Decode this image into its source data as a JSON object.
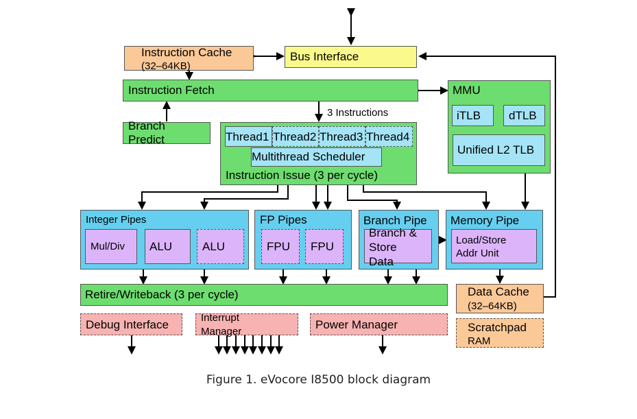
{
  "blocks": {
    "instruction_cache": {
      "title": "Instruction Cache",
      "subtitle": "(32–64KB)"
    },
    "bus_interface": {
      "title": "Bus Interface"
    },
    "instruction_fetch": {
      "title": "Instruction Fetch"
    },
    "branch_predict": {
      "title": "Branch",
      "title2": "Predict"
    },
    "mmu": {
      "title": "MMU",
      "itlb": "iTLB",
      "dtlb": "dTLB",
      "l2tlb": "Unified L2 TLB"
    },
    "fetch_to_issue_label": "3 Instructions",
    "issue": {
      "threads": [
        "Thread1",
        "Thread2",
        "Thread3",
        "Thread4"
      ],
      "scheduler": "Multithread Scheduler",
      "title": "Instruction Issue (3 per cycle)"
    },
    "integer_pipes": {
      "title": "Integer Pipes",
      "units": [
        "Mul/Div",
        "ALU",
        "ALU"
      ]
    },
    "fp_pipes": {
      "title": "FP Pipes",
      "units": [
        "FPU",
        "FPU"
      ]
    },
    "branch_pipe": {
      "title": "Branch Pipe",
      "unit_lines": [
        "Branch &",
        "Store",
        "Data"
      ]
    },
    "memory_pipe": {
      "title": "Memory Pipe",
      "unit_lines": [
        "Load/Store",
        "Addr Unit"
      ]
    },
    "retire": {
      "title": "Retire/Writeback (3 per cycle)"
    },
    "data_cache": {
      "title": "Data Cache",
      "subtitle": "(32–64KB)"
    },
    "debug_interface": {
      "title": "Debug Interface"
    },
    "interrupt_manager": {
      "title": "Interrupt",
      "title2": "Manager"
    },
    "power_manager": {
      "title": "Power Manager"
    },
    "scratchpad": {
      "title": "Scratchpad",
      "subtitle": "RAM"
    }
  },
  "caption": "Figure 1. eVocore I8500 block diagram"
}
